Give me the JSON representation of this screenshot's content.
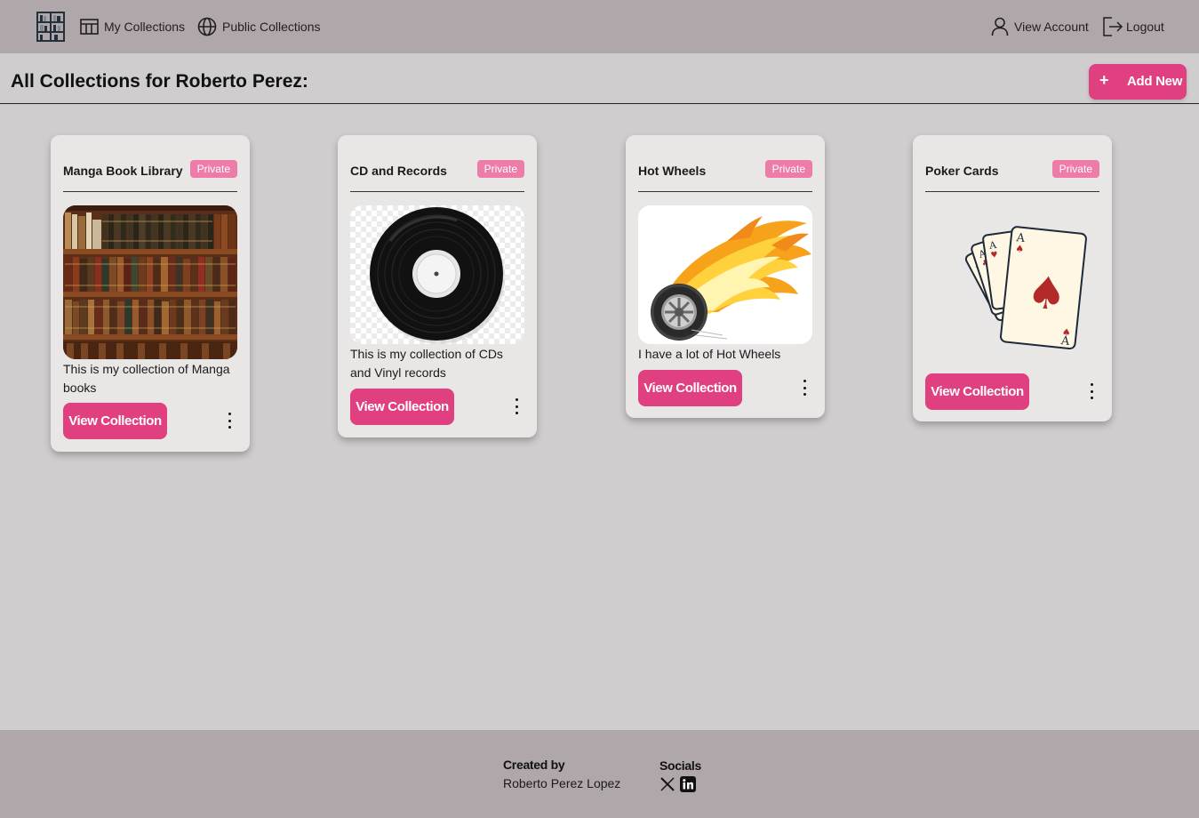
{
  "nav": {
    "logo_icon": "bookshelf-icon",
    "my_collections": "My Collections",
    "public_collections": "Public Collections",
    "view_account": "View Account",
    "logout": "Logout"
  },
  "header": {
    "title": "All Collections for Roberto Perez:",
    "add_new_label": "Add New",
    "add_new_icon": "+"
  },
  "collections": [
    {
      "title": "Manga Book Library",
      "visibility": "Private",
      "description": "This is my collection of Manga books",
      "image": "bookshelf-photo",
      "button": "View Collection"
    },
    {
      "title": "CD and Records",
      "visibility": "Private",
      "description": "This is my collection of CDs and Vinyl records",
      "image": "vinyl-record",
      "button": "View Collection"
    },
    {
      "title": "Hot Wheels",
      "visibility": "Private",
      "description": "I have a lot of Hot Wheels",
      "image": "flaming-wheel",
      "button": "View Collection"
    },
    {
      "title": "Poker Cards",
      "visibility": "Private",
      "description": "",
      "image": "playing-cards",
      "button": "View Collection"
    }
  ],
  "footer": {
    "created_by_heading": "Created by",
    "created_by_name": "Roberto Perez Lopez",
    "socials_heading": "Socials",
    "socials": [
      "x-icon",
      "linkedin-icon"
    ]
  },
  "colors": {
    "nav_bg": "#b0a7aa",
    "page_bg": "#cfcdce",
    "card_bg": "#e9e7e6",
    "accent": "#e0407f",
    "badge": "#ee7ca8"
  }
}
